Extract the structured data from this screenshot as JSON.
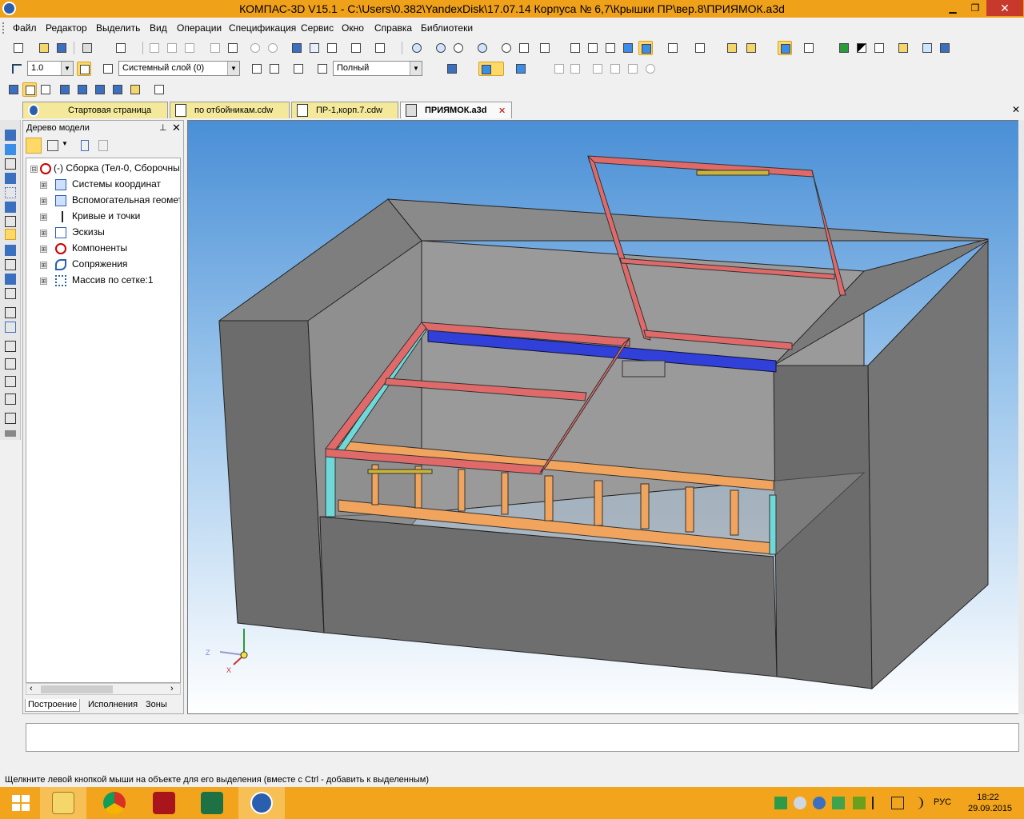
{
  "window": {
    "title": "КОМПАС-3D V15.1 - C:\\Users\\0.382\\YandexDisk\\17.07.14 Корпуса № 6,7\\Крышки ПР\\вер.8\\ПРИЯМОК.a3d",
    "minimize_glyph": "▁",
    "maximize_glyph": "❐",
    "close_glyph": "✕"
  },
  "menu": [
    "Файл",
    "Редактор",
    "Выделить",
    "Вид",
    "Операции",
    "Спецификация",
    "Сервис",
    "Окно",
    "Справка",
    "Библиотеки"
  ],
  "toolbar": {
    "scale_value": "1.0",
    "layer_value": "Системный слой (0)",
    "display_mode_value": "Полный"
  },
  "tabs": [
    {
      "label": "Стартовая страница",
      "active": false
    },
    {
      "label": "по отбойникам.cdw",
      "active": false
    },
    {
      "label": "ПР-1,корп.7.cdw",
      "active": false
    },
    {
      "label": "ПРИЯМОК.a3d",
      "active": true
    }
  ],
  "tab_close_glyph": "✕",
  "panel": {
    "title": "Дерево модели",
    "pin_glyph": "⊥",
    "close_glyph": "✕",
    "tree": [
      {
        "label": "(-) Сборка (Тел-0, Сборочны",
        "icon": "assembly-error-icon",
        "level": 0,
        "expander": "⊟"
      },
      {
        "label": "Системы координат",
        "icon": "coordinate-system-icon",
        "level": 1,
        "expander": "⊞"
      },
      {
        "label": "Вспомогательная геомет",
        "icon": "auxiliary-geometry-icon",
        "level": 1,
        "expander": "⊞"
      },
      {
        "label": "Кривые и точки",
        "icon": "curves-icon",
        "level": 1,
        "expander": "⊞"
      },
      {
        "label": "Эскизы",
        "icon": "sketch-icon",
        "level": 1,
        "expander": "⊞"
      },
      {
        "label": "Компоненты",
        "icon": "components-error-icon",
        "level": 1,
        "expander": "⊞"
      },
      {
        "label": "Сопряжения",
        "icon": "mates-icon",
        "level": 1,
        "expander": "⊞"
      },
      {
        "label": "Массив по сетке:1",
        "icon": "grid-pattern-icon",
        "level": 1,
        "expander": "⊞"
      }
    ],
    "bottom_tabs": [
      "Построение",
      "Исполнения",
      "Зоны"
    ],
    "scroll_left_glyph": "‹",
    "scroll_right_glyph": "›"
  },
  "viewport": {
    "axis_labels": {
      "z": "Z",
      "x": "X"
    }
  },
  "status_text": "Щелкните левой кнопкой мыши на объекте для его выделения (вместе с Ctrl - добавить к выделенным)",
  "tray": {
    "language": "РУС",
    "time": "18:22",
    "date": "29.09.2015"
  },
  "colors": {
    "titlebar": "#f0a11a",
    "taskbar": "#f2a51c",
    "frame_red": "#e06a6a",
    "frame_orange": "#f0a45e",
    "blue_beam": "#3040d8",
    "concrete": "#8a8a8a"
  }
}
